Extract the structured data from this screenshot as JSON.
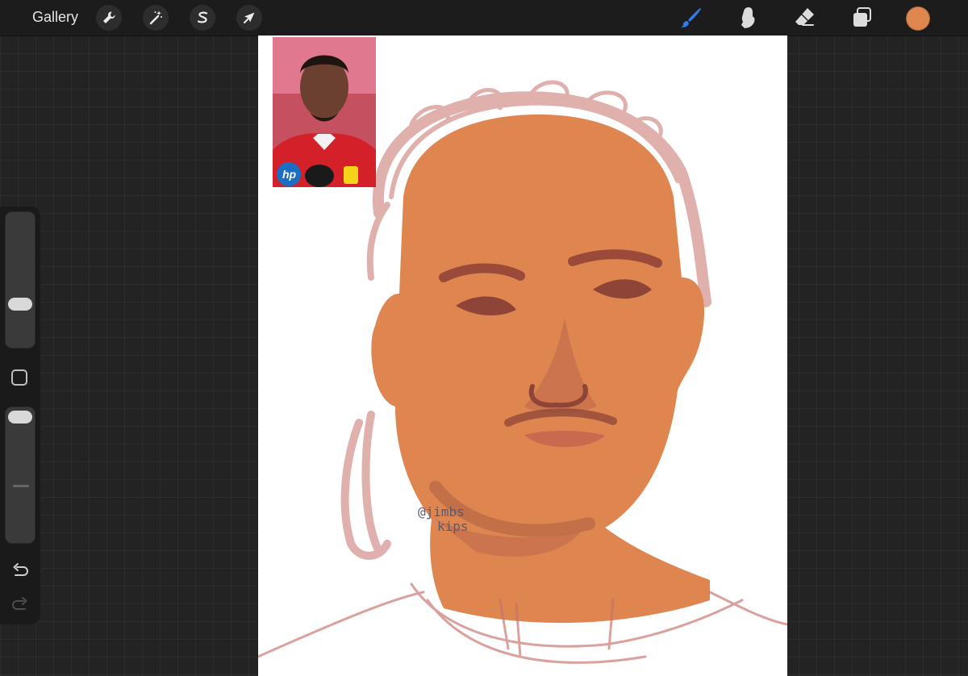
{
  "topbar": {
    "gallery_label": "Gallery",
    "left_tools": [
      {
        "name": "adjustments",
        "icon": "wrench-icon"
      },
      {
        "name": "adjust",
        "icon": "magic-wand-icon"
      },
      {
        "name": "selection",
        "icon": "selection-s-icon"
      },
      {
        "name": "transform",
        "icon": "arrow-cursor-icon"
      }
    ],
    "right_tools": [
      {
        "name": "brush",
        "icon": "brush-icon",
        "active": true
      },
      {
        "name": "smudge",
        "icon": "smudge-finger-icon"
      },
      {
        "name": "eraser",
        "icon": "eraser-icon"
      },
      {
        "name": "layers",
        "icon": "layers-icon"
      }
    ],
    "current_color": "#e0874f",
    "active_tool_color": "#2f7bf5"
  },
  "sidebar": {
    "brush_size_level": 0.3,
    "opacity_level": 1.0
  },
  "reference": {
    "badge_text": "hp"
  },
  "canvas": {
    "signature_line1": "@jimbs",
    "signature_line2": "kips",
    "skin_color": "#de8550",
    "sketch_color": "#c7706b"
  }
}
